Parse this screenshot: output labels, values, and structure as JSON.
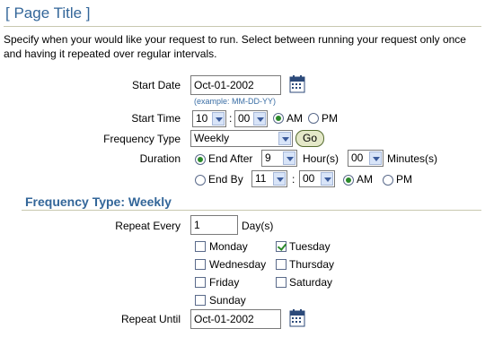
{
  "page": {
    "title": "[ Page Title ]",
    "instructions": "Specify when your would like your request to run. Select between running your request only once and having it repeated over regular intervals."
  },
  "start_date": {
    "label": "Start Date",
    "value": "Oct-01-2002",
    "hint": "(example: MM-DD-YY)",
    "icon": "calendar-icon"
  },
  "start_time": {
    "label": "Start Time",
    "hour": "10",
    "minute": "00",
    "separator": ":",
    "am": "AM",
    "pm": "PM",
    "selected": "AM"
  },
  "frequency": {
    "label": "Frequency Type",
    "value": "Weekly",
    "go": "Go"
  },
  "duration": {
    "label": "Duration",
    "end_after_label": "End After",
    "end_after_hours": "9",
    "hours_label": "Hour(s)",
    "end_after_minutes": "00",
    "minutes_label": "Minutes(s)",
    "end_by_label": "End By",
    "end_by_hour": "11",
    "separator": ":",
    "end_by_minute": "00",
    "am": "AM",
    "pm": "PM",
    "selected_mode": "End After",
    "end_by_selected_ampm": "AM"
  },
  "weekly": {
    "section_title": "Frequency Type: Weekly",
    "repeat_every_label": "Repeat Every",
    "repeat_every_value": "1",
    "repeat_every_unit": "Day(s)",
    "days": [
      {
        "label": "Monday",
        "checked": false
      },
      {
        "label": "Tuesday",
        "checked": true
      },
      {
        "label": "Wednesday",
        "checked": false
      },
      {
        "label": "Thursday",
        "checked": false
      },
      {
        "label": "Friday",
        "checked": false
      },
      {
        "label": "Saturday",
        "checked": false
      },
      {
        "label": "Sunday",
        "checked": false
      }
    ],
    "repeat_until_label": "Repeat Until",
    "repeat_until_value": "Oct-01-2002"
  },
  "colors": {
    "title": "#336699",
    "accent": "#2a8a2a",
    "rule": "#c8c8b0"
  }
}
